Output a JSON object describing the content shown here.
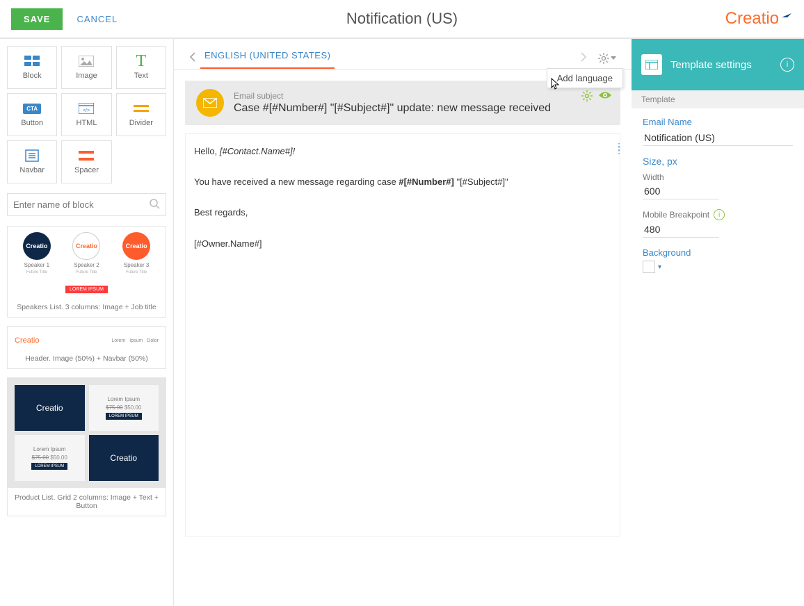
{
  "topbar": {
    "save": "SAVE",
    "cancel": "CANCEL",
    "title": "Notification (US)",
    "logo": "Creatio"
  },
  "blocks": [
    {
      "key": "block",
      "label": "Block",
      "icon": "grid"
    },
    {
      "key": "image",
      "label": "Image",
      "icon": "image"
    },
    {
      "key": "text",
      "label": "Text",
      "icon": "text"
    },
    {
      "key": "button",
      "label": "Button",
      "icon": "cta"
    },
    {
      "key": "html",
      "label": "HTML",
      "icon": "code"
    },
    {
      "key": "divider",
      "label": "Divider",
      "icon": "divider"
    },
    {
      "key": "navbar",
      "label": "Navbar",
      "icon": "navbar"
    },
    {
      "key": "spacer",
      "label": "Spacer",
      "icon": "spacer"
    }
  ],
  "search": {
    "placeholder": "Enter name of block"
  },
  "previews": {
    "speakers": {
      "caption": "Speakers List. 3 columns: Image + Job title",
      "items": [
        "Speaker 1",
        "Speaker 2",
        "Speaker 3"
      ],
      "sub": "Future Title",
      "badge": "LOREM IPSUM",
      "logo": "Creatio"
    },
    "header": {
      "caption": "Header. Image (50%) + Navbar (50%)",
      "logo": "Creatio",
      "nav": [
        "Lorem",
        "Ipsum",
        "Dolor"
      ]
    },
    "product": {
      "caption": "Product List. Grid 2 columns: Image + Text + Button",
      "logo": "Creatio",
      "text": "Lorem Ipsum",
      "old_price": "$75.00",
      "new_price": "$50.00",
      "btn": "LOREM IPSUM"
    }
  },
  "tab": {
    "label": "ENGLISH (UNITED STATES)"
  },
  "gearMenu": {
    "add_language": "Add language"
  },
  "subject": {
    "label": "Email subject",
    "value": "Case #[#Number#] \"[#Subject#]\" update: new message received"
  },
  "body": {
    "line1a": "Hello, ",
    "line1b": "[#Contact.Name#]!",
    "line2a": "You have received a new message regarding case ",
    "line2b": "#[#Number#]",
    "line2c": " \"[#Subject#]\"",
    "line3": "Best regards,",
    "line4": "[#Owner.Name#]"
  },
  "settings": {
    "header": "Template settings",
    "section": "Template",
    "email_name": {
      "label": "Email Name",
      "value": "Notification (US)"
    },
    "size": {
      "label": "Size, px",
      "width_label": "Width",
      "width": "600",
      "breakpoint_label": "Mobile Breakpoint",
      "breakpoint": "480"
    },
    "background": {
      "label": "Background"
    }
  }
}
